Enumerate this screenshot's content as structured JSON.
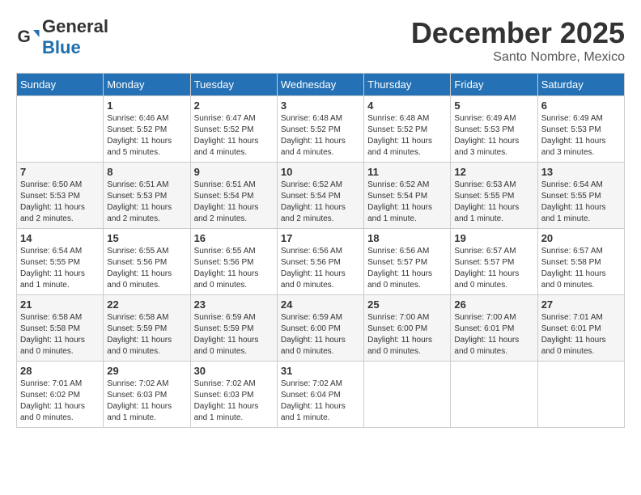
{
  "header": {
    "logo_general": "General",
    "logo_blue": "Blue",
    "month_title": "December 2025",
    "location": "Santo Nombre, Mexico"
  },
  "weekdays": [
    "Sunday",
    "Monday",
    "Tuesday",
    "Wednesday",
    "Thursday",
    "Friday",
    "Saturday"
  ],
  "weeks": [
    [
      {
        "day": "",
        "info": ""
      },
      {
        "day": "1",
        "info": "Sunrise: 6:46 AM\nSunset: 5:52 PM\nDaylight: 11 hours\nand 5 minutes."
      },
      {
        "day": "2",
        "info": "Sunrise: 6:47 AM\nSunset: 5:52 PM\nDaylight: 11 hours\nand 4 minutes."
      },
      {
        "day": "3",
        "info": "Sunrise: 6:48 AM\nSunset: 5:52 PM\nDaylight: 11 hours\nand 4 minutes."
      },
      {
        "day": "4",
        "info": "Sunrise: 6:48 AM\nSunset: 5:52 PM\nDaylight: 11 hours\nand 4 minutes."
      },
      {
        "day": "5",
        "info": "Sunrise: 6:49 AM\nSunset: 5:53 PM\nDaylight: 11 hours\nand 3 minutes."
      },
      {
        "day": "6",
        "info": "Sunrise: 6:49 AM\nSunset: 5:53 PM\nDaylight: 11 hours\nand 3 minutes."
      }
    ],
    [
      {
        "day": "7",
        "info": "Sunrise: 6:50 AM\nSunset: 5:53 PM\nDaylight: 11 hours\nand 2 minutes."
      },
      {
        "day": "8",
        "info": "Sunrise: 6:51 AM\nSunset: 5:53 PM\nDaylight: 11 hours\nand 2 minutes."
      },
      {
        "day": "9",
        "info": "Sunrise: 6:51 AM\nSunset: 5:54 PM\nDaylight: 11 hours\nand 2 minutes."
      },
      {
        "day": "10",
        "info": "Sunrise: 6:52 AM\nSunset: 5:54 PM\nDaylight: 11 hours\nand 2 minutes."
      },
      {
        "day": "11",
        "info": "Sunrise: 6:52 AM\nSunset: 5:54 PM\nDaylight: 11 hours\nand 1 minute."
      },
      {
        "day": "12",
        "info": "Sunrise: 6:53 AM\nSunset: 5:55 PM\nDaylight: 11 hours\nand 1 minute."
      },
      {
        "day": "13",
        "info": "Sunrise: 6:54 AM\nSunset: 5:55 PM\nDaylight: 11 hours\nand 1 minute."
      }
    ],
    [
      {
        "day": "14",
        "info": "Sunrise: 6:54 AM\nSunset: 5:55 PM\nDaylight: 11 hours\nand 1 minute."
      },
      {
        "day": "15",
        "info": "Sunrise: 6:55 AM\nSunset: 5:56 PM\nDaylight: 11 hours\nand 0 minutes."
      },
      {
        "day": "16",
        "info": "Sunrise: 6:55 AM\nSunset: 5:56 PM\nDaylight: 11 hours\nand 0 minutes."
      },
      {
        "day": "17",
        "info": "Sunrise: 6:56 AM\nSunset: 5:56 PM\nDaylight: 11 hours\nand 0 minutes."
      },
      {
        "day": "18",
        "info": "Sunrise: 6:56 AM\nSunset: 5:57 PM\nDaylight: 11 hours\nand 0 minutes."
      },
      {
        "day": "19",
        "info": "Sunrise: 6:57 AM\nSunset: 5:57 PM\nDaylight: 11 hours\nand 0 minutes."
      },
      {
        "day": "20",
        "info": "Sunrise: 6:57 AM\nSunset: 5:58 PM\nDaylight: 11 hours\nand 0 minutes."
      }
    ],
    [
      {
        "day": "21",
        "info": "Sunrise: 6:58 AM\nSunset: 5:58 PM\nDaylight: 11 hours\nand 0 minutes."
      },
      {
        "day": "22",
        "info": "Sunrise: 6:58 AM\nSunset: 5:59 PM\nDaylight: 11 hours\nand 0 minutes."
      },
      {
        "day": "23",
        "info": "Sunrise: 6:59 AM\nSunset: 5:59 PM\nDaylight: 11 hours\nand 0 minutes."
      },
      {
        "day": "24",
        "info": "Sunrise: 6:59 AM\nSunset: 6:00 PM\nDaylight: 11 hours\nand 0 minutes."
      },
      {
        "day": "25",
        "info": "Sunrise: 7:00 AM\nSunset: 6:00 PM\nDaylight: 11 hours\nand 0 minutes."
      },
      {
        "day": "26",
        "info": "Sunrise: 7:00 AM\nSunset: 6:01 PM\nDaylight: 11 hours\nand 0 minutes."
      },
      {
        "day": "27",
        "info": "Sunrise: 7:01 AM\nSunset: 6:01 PM\nDaylight: 11 hours\nand 0 minutes."
      }
    ],
    [
      {
        "day": "28",
        "info": "Sunrise: 7:01 AM\nSunset: 6:02 PM\nDaylight: 11 hours\nand 0 minutes."
      },
      {
        "day": "29",
        "info": "Sunrise: 7:02 AM\nSunset: 6:03 PM\nDaylight: 11 hours\nand 1 minute."
      },
      {
        "day": "30",
        "info": "Sunrise: 7:02 AM\nSunset: 6:03 PM\nDaylight: 11 hours\nand 1 minute."
      },
      {
        "day": "31",
        "info": "Sunrise: 7:02 AM\nSunset: 6:04 PM\nDaylight: 11 hours\nand 1 minute."
      },
      {
        "day": "",
        "info": ""
      },
      {
        "day": "",
        "info": ""
      },
      {
        "day": "",
        "info": ""
      }
    ]
  ]
}
